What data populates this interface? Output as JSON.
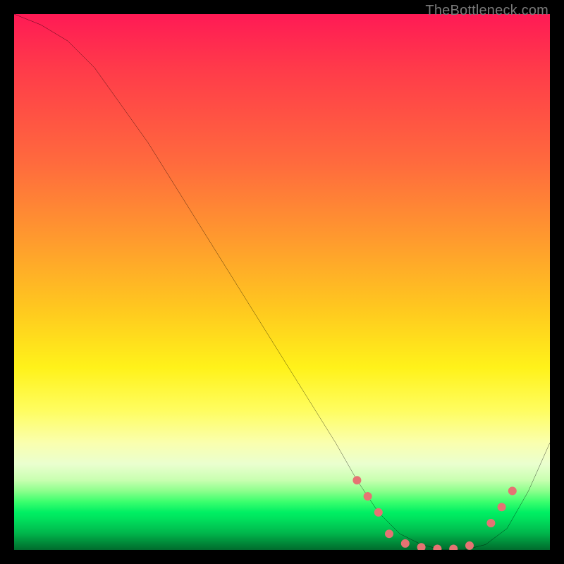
{
  "attribution": "TheBottleneck.com",
  "chart_data": {
    "type": "line",
    "title": "",
    "xlabel": "",
    "ylabel": "",
    "xlim": [
      0,
      100
    ],
    "ylim": [
      0,
      100
    ],
    "grid": false,
    "legend": false,
    "background_gradient": {
      "direction": "vertical",
      "stops": [
        {
          "pos": 0.0,
          "color": "#ff1a55"
        },
        {
          "pos": 0.3,
          "color": "#ff7a35"
        },
        {
          "pos": 0.55,
          "color": "#ffc81f"
        },
        {
          "pos": 0.75,
          "color": "#fff96a"
        },
        {
          "pos": 0.88,
          "color": "#c8ffb0"
        },
        {
          "pos": 0.93,
          "color": "#00ef63"
        },
        {
          "pos": 1.0,
          "color": "#006b2d"
        }
      ]
    },
    "series": [
      {
        "name": "bottleneck-curve",
        "color": "#000000",
        "x": [
          0,
          5,
          10,
          15,
          20,
          25,
          30,
          35,
          40,
          45,
          50,
          55,
          60,
          64,
          68,
          72,
          76,
          80,
          84,
          88,
          92,
          96,
          100
        ],
        "y": [
          100,
          98,
          95,
          90,
          83,
          76,
          68,
          60,
          52,
          44,
          36,
          28,
          20,
          13,
          7,
          3,
          1,
          0,
          0,
          1,
          4,
          11,
          20
        ]
      }
    ],
    "markers": {
      "name": "highlight-dots",
      "color": "#e57373",
      "radius": 6,
      "points": [
        {
          "x": 64,
          "y": 13
        },
        {
          "x": 66,
          "y": 10
        },
        {
          "x": 68,
          "y": 7
        },
        {
          "x": 70,
          "y": 3
        },
        {
          "x": 73,
          "y": 1.2
        },
        {
          "x": 76,
          "y": 0.5
        },
        {
          "x": 79,
          "y": 0.2
        },
        {
          "x": 82,
          "y": 0.2
        },
        {
          "x": 85,
          "y": 0.8
        },
        {
          "x": 89,
          "y": 5
        },
        {
          "x": 91,
          "y": 8
        },
        {
          "x": 93,
          "y": 11
        }
      ]
    }
  }
}
